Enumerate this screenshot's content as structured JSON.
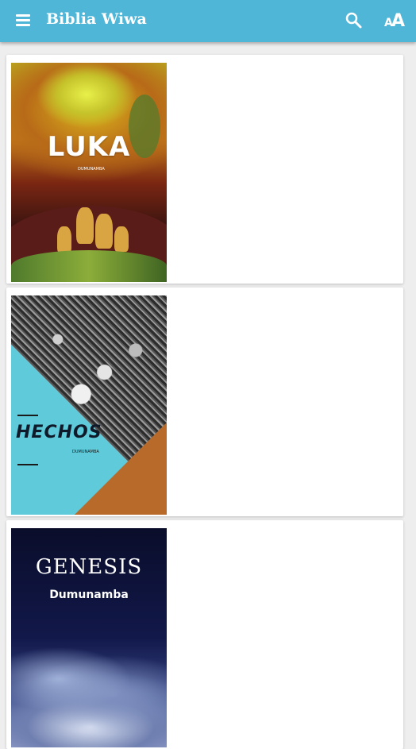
{
  "appbar": {
    "title": "Biblia Wiwa",
    "menu_icon": "hamburger-menu-icon",
    "search_icon": "search-icon",
    "text_size_icon": "text-size-icon",
    "text_size_small": "A",
    "text_size_big": "A",
    "bg_color": "#4fb6d7"
  },
  "books": [
    {
      "title": "LUKA",
      "subtitle": "DUMUNAMBA"
    },
    {
      "title": "HECHOS",
      "subtitle": "DUMUNAMBA"
    },
    {
      "title": "GENESIS",
      "subtitle": "Dumunamba"
    }
  ]
}
